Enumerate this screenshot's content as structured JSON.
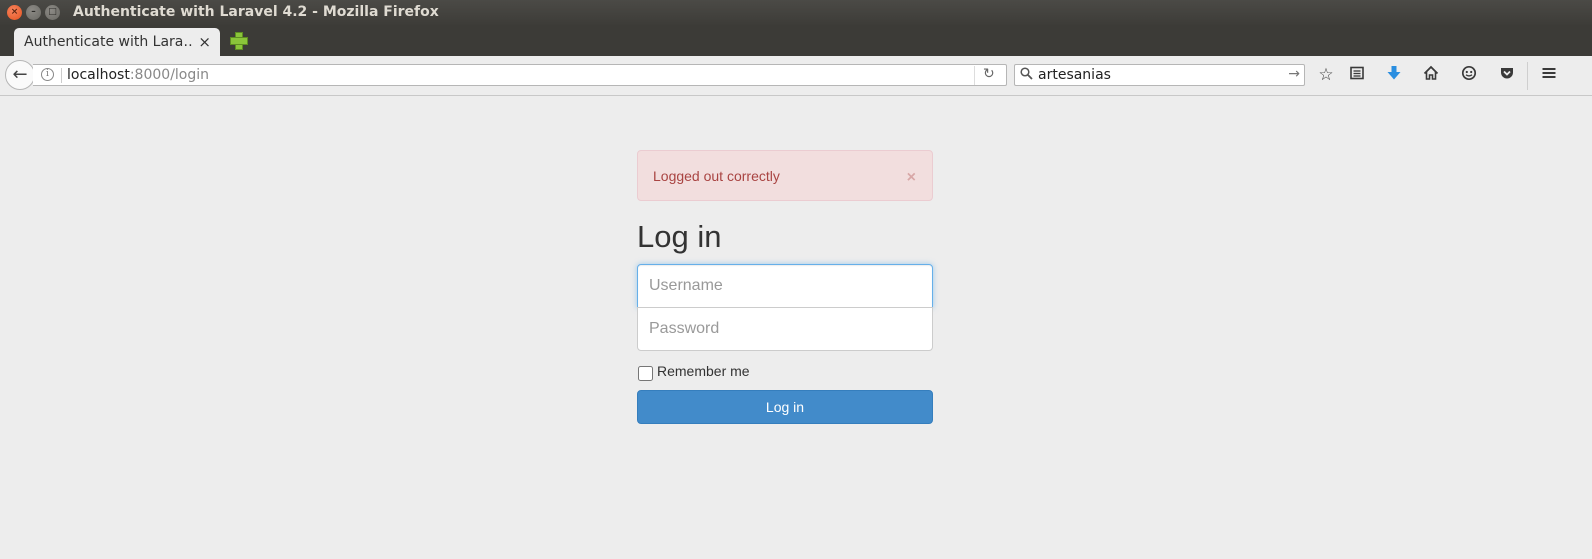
{
  "window": {
    "title": "Authenticate with Laravel 4.2 - Mozilla Firefox",
    "close_glyph": "×",
    "min_glyph": "–",
    "max_glyph": "□"
  },
  "tabs": [
    {
      "label": "Authenticate with Lara…",
      "close_glyph": "×",
      "active": true
    }
  ],
  "toolbar": {
    "url_host": "localhost",
    "url_rest": ":8000/login",
    "search_value": "artesanias",
    "icons": [
      "back-icon",
      "info-icon",
      "reload-icon",
      "search-icon",
      "search-go-icon",
      "bookmark-star-icon",
      "reading-list-icon",
      "download-icon",
      "home-icon",
      "chat-icon",
      "pocket-icon",
      "hamburger-menu-icon"
    ]
  },
  "page": {
    "alert": {
      "text": "Logged out correctly",
      "close_glyph": "×",
      "color": "#a94442",
      "background": "#f2dede"
    },
    "heading": "Log in",
    "username_placeholder": "Username",
    "password_placeholder": "Password",
    "remember_label": "Remember me",
    "login_button": "Log in",
    "accent": "#428bca"
  }
}
